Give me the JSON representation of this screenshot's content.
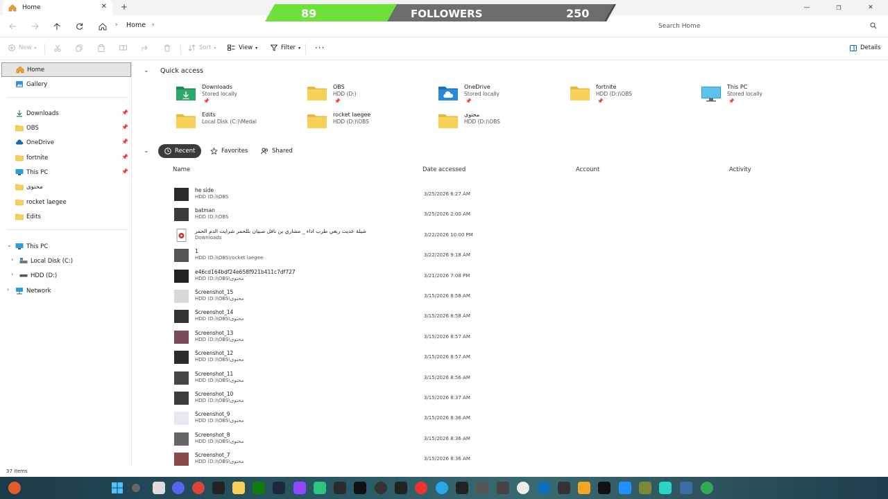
{
  "tab": {
    "title": "Home"
  },
  "overlay": {
    "count_left": "89",
    "label": "FOLLOWERS",
    "count_right": "250"
  },
  "address": {
    "crumb": "Home",
    "search_placeholder": "Search Home"
  },
  "command_bar": {
    "new": "New",
    "sort": "Sort",
    "view": "View",
    "filter": "Filter",
    "details": "Details"
  },
  "sidebar": {
    "home": "Home",
    "gallery": "Gallery",
    "pinned": [
      "Downloads",
      "OBS",
      "OneDrive",
      "fortnite",
      "This PC"
    ],
    "others": [
      "محتوى",
      "rocket laegee",
      "Edits"
    ],
    "this_pc": "This PC",
    "drives": [
      "Local Disk (C:)",
      "HDD (D:)"
    ],
    "network": "Network"
  },
  "quick_access": {
    "title": "Quick access",
    "items": [
      {
        "name": "Downloads",
        "sub": "Stored locally",
        "pinned": true,
        "icon": "downloads-folder"
      },
      {
        "name": "OBS",
        "sub": "HDD (D:)",
        "pinned": true,
        "icon": "folder"
      },
      {
        "name": "OneDrive",
        "sub": "Stored locally",
        "pinned": true,
        "icon": "onedrive-folder"
      },
      {
        "name": "fortnite",
        "sub": "HDD (D:)\\OBS",
        "pinned": true,
        "icon": "folder"
      },
      {
        "name": "This PC",
        "sub": "Stored locally",
        "pinned": true,
        "icon": "monitor"
      },
      {
        "name": "Edits",
        "sub": "Local Disk (C:)\\Medal",
        "pinned": false,
        "icon": "folder"
      },
      {
        "name": "rocket laegee",
        "sub": "HDD (D:)\\OBS",
        "pinned": false,
        "icon": "folder"
      },
      {
        "name": "محتوى",
        "sub": "HDD (D:)\\OBS",
        "pinned": false,
        "icon": "folder"
      }
    ]
  },
  "recent": {
    "tabs": [
      "Recent",
      "Favorites",
      "Shared"
    ],
    "columns": [
      "Name",
      "Date accessed",
      "Account",
      "Activity"
    ],
    "rows": [
      {
        "name": "he side",
        "path": "HDD (D:)\\OBS",
        "date": "3/25/2026 6:27 AM"
      },
      {
        "name": "batman",
        "path": "HDD (D:)\\OBS",
        "date": "3/25/2026 2:00 AM"
      },
      {
        "name": "شيلة عديت ربعي  طرب  اداء _ مشاري بن نافل  صبيان بللحمر شرايت الدم الحمر",
        "path": "Downloads",
        "date": "3/22/2026 10:00 PM"
      },
      {
        "name": "1",
        "path": "HDD (D:)\\OBS\\rocket laegee",
        "date": "3/22/2026 9:18 AM"
      },
      {
        "name": "e46cd164bdf24e658f921b411c7df727",
        "path": "HDD (D:)\\OBS\\محتوى",
        "date": "3/21/2026 7:08 PM"
      },
      {
        "name": "Screenshot_15",
        "path": "HDD (D:)\\OBS\\محتوى",
        "date": "3/15/2026 8:58 AM"
      },
      {
        "name": "Screenshot_14",
        "path": "HDD (D:)\\OBS\\محتوى",
        "date": "3/15/2026 8:58 AM"
      },
      {
        "name": "Screenshot_13",
        "path": "HDD (D:)\\OBS\\محتوى",
        "date": "3/15/2026 8:57 AM"
      },
      {
        "name": "Screenshot_12",
        "path": "HDD (D:)\\OBS\\محتوى",
        "date": "3/15/2026 8:57 AM"
      },
      {
        "name": "Screenshot_11",
        "path": "HDD (D:)\\OBS\\محتوى",
        "date": "3/15/2026 8:56 AM"
      },
      {
        "name": "Screenshot_10",
        "path": "HDD (D:)\\OBS\\محتوى",
        "date": "3/15/2026 8:37 AM"
      },
      {
        "name": "Screenshot_9",
        "path": "HDD (D:)\\OBS\\محتوى",
        "date": "3/15/2026 8:36 AM"
      },
      {
        "name": "Screenshot_8",
        "path": "HDD (D:)\\OBS\\محتوى",
        "date": "3/15/2026 8:36 AM"
      },
      {
        "name": "Screenshot_7",
        "path": "HDD (D:)\\OBS\\محتوى",
        "date": "3/15/2026 8:36 AM"
      }
    ]
  },
  "status": {
    "count": "37 items"
  },
  "colors": {
    "folder": "#f7d05a",
    "overlay_green": "#6ee03a",
    "overlay_grey": "#6d6d6d",
    "accent": "#0067c0"
  }
}
